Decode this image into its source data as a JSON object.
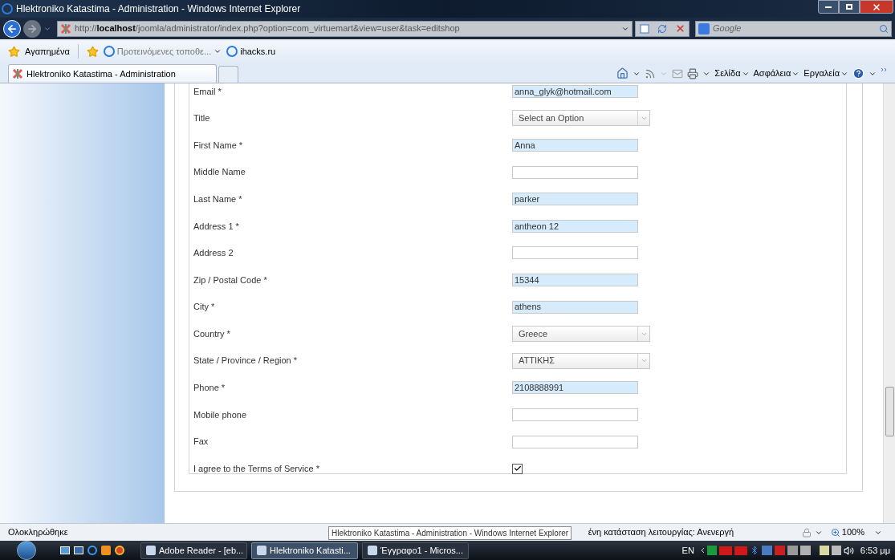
{
  "window": {
    "title": "Hlektroniko Katastima - Administration - Windows Internet Explorer"
  },
  "address_bar": {
    "url_prefix": "http://",
    "url_host": "localhost",
    "url_rest": "/joomla/administrator/index.php?option=com_virtuemart&view=user&task=editshop",
    "search_placeholder": "Google"
  },
  "favorites_bar": {
    "favorites_label": "Αγαπημένα",
    "links": [
      "Προτεινόμενες τοποθε...",
      "ihacks.ru"
    ]
  },
  "tab": {
    "title": "Hlektroniko Katastima - Administration"
  },
  "command_bar": [
    "Σελίδα",
    "Ασφάλεια",
    "Εργαλεία"
  ],
  "form": {
    "rows": [
      {
        "kind": "text",
        "label": "Email *",
        "value": "anna_glyk@hotmail.com"
      },
      {
        "kind": "select",
        "label": "Title",
        "value": "Select an Option"
      },
      {
        "kind": "text",
        "label": "First Name *",
        "value": "Anna"
      },
      {
        "kind": "text",
        "label": "Middle Name"
      },
      {
        "kind": "text",
        "label": "Last Name *",
        "value": "parker"
      },
      {
        "kind": "text",
        "label": "Address 1 *",
        "value": "antheon 12"
      },
      {
        "kind": "text",
        "label": "Address 2"
      },
      {
        "kind": "text",
        "label": "Zip / Postal Code *",
        "value": "15344"
      },
      {
        "kind": "text",
        "label": "City *",
        "value": "athens"
      },
      {
        "kind": "select",
        "label": "Country *",
        "value": "Greece"
      },
      {
        "kind": "select",
        "label": "State / Province / Region *",
        "value": "ΑΤΤΙΚΗΣ"
      },
      {
        "kind": "text",
        "label": "Phone *",
        "value": "2108888991"
      },
      {
        "kind": "text",
        "label": "Mobile phone"
      },
      {
        "kind": "text",
        "label": "Fax"
      },
      {
        "kind": "checkbox",
        "label": "I agree to the Terms of Service *",
        "checked": true
      }
    ]
  },
  "status_bar": {
    "text": "Ολοκληρώθηκε",
    "mode_text": "ένη κατάσταση λειτουργίας: Ανενεργή",
    "zoom": "100%",
    "tooltip": "Hlektroniko Katastima - Administration - Windows Internet Explorer"
  },
  "taskbar": {
    "items": [
      {
        "label": "Adobe Reader - [eb...",
        "selected": false
      },
      {
        "label": "Hlektroniko Katasti...",
        "selected": true
      },
      {
        "label": "Έγγραφο1 - Micros...",
        "selected": false
      }
    ],
    "language": "EN",
    "clock": "6:53 μμ"
  }
}
